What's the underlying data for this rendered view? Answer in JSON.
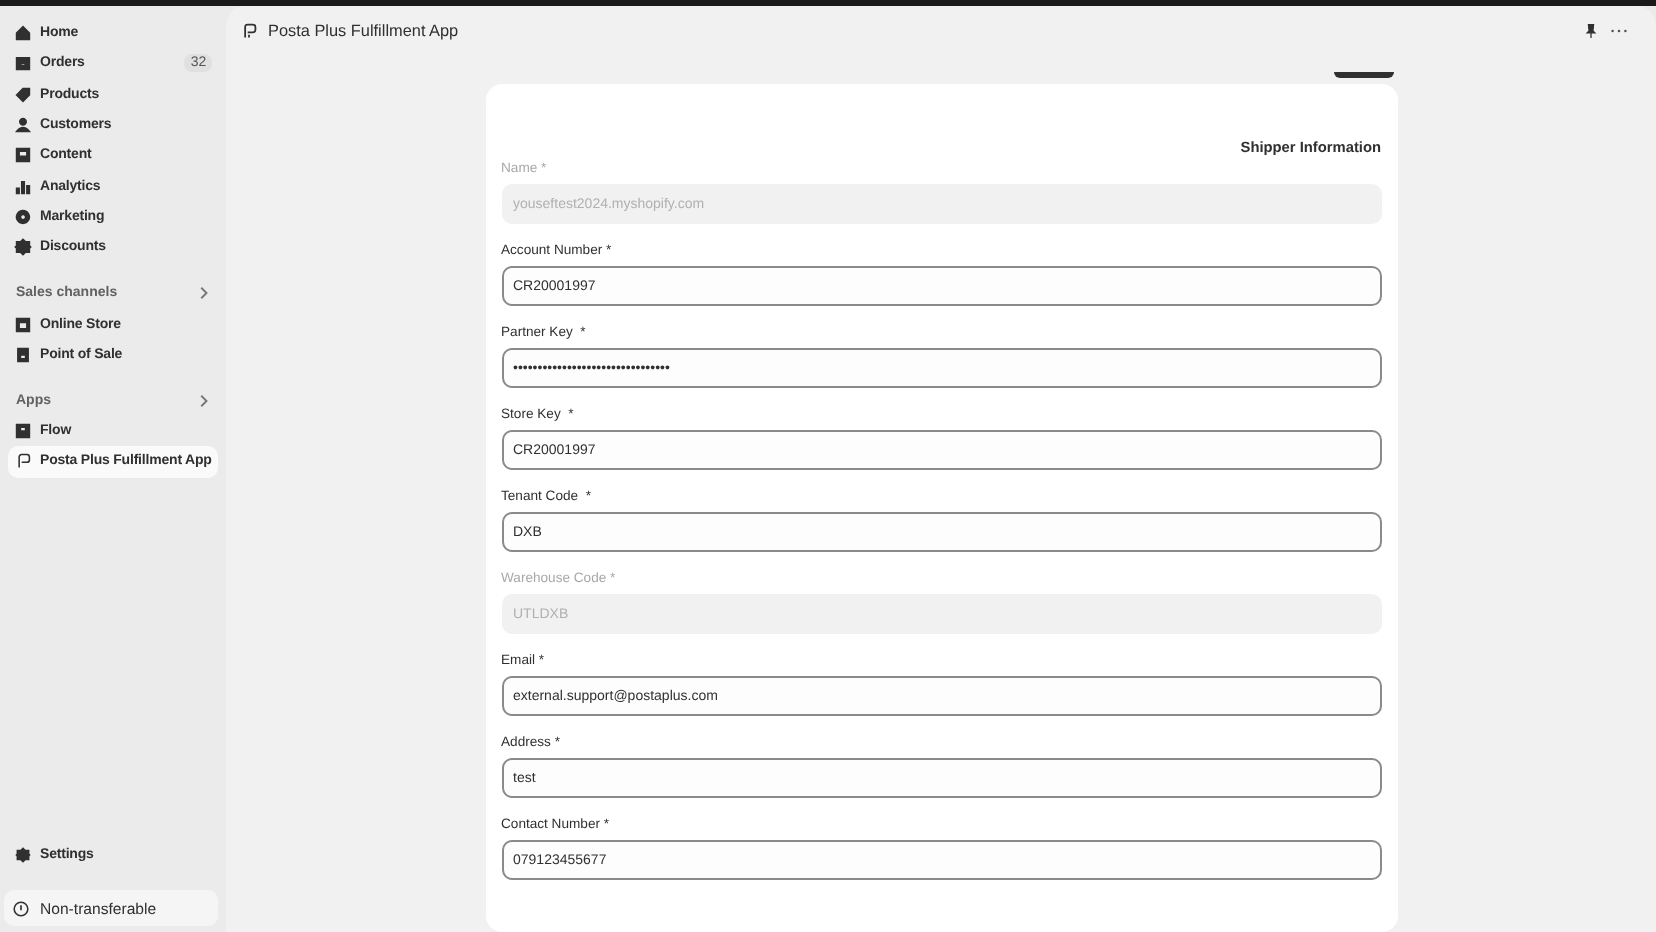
{
  "sidebar": {
    "items": [
      {
        "label": "Home",
        "selected": false
      },
      {
        "label": "Orders",
        "badge": "32",
        "selected": false
      },
      {
        "label": "Products",
        "selected": false
      },
      {
        "label": "Customers",
        "selected": false
      },
      {
        "label": "Content",
        "selected": false
      },
      {
        "label": "Analytics",
        "selected": false
      },
      {
        "label": "Marketing",
        "selected": false
      },
      {
        "label": "Discounts",
        "selected": false
      }
    ],
    "sections": [
      {
        "title": "Sales channels",
        "items": [
          {
            "label": "Online Store",
            "selected": false
          },
          {
            "label": "Point of Sale",
            "selected": false
          }
        ]
      },
      {
        "title": "Apps",
        "items": [
          {
            "label": "Flow",
            "selected": false
          },
          {
            "label": "Posta Plus Fulfillment App",
            "selected": true
          }
        ]
      }
    ],
    "settings": "Settings",
    "footer": "Non-transferable"
  },
  "app_title": "Posta Plus Fulfillment App",
  "form": {
    "heading": "Shipper Information",
    "fields": [
      {
        "label": "Name *",
        "value": "youseftest2024.myshopify.com",
        "disabled": true
      },
      {
        "label": "Account Number *",
        "value": "CR20001997",
        "disabled": false
      },
      {
        "label": "Partner Key  *",
        "value": "••••••••••••••••••••••••••••••••",
        "disabled": false
      },
      {
        "label": "Store Key  *",
        "value": "CR20001997",
        "disabled": false
      },
      {
        "label": "Tenant Code  *",
        "value": "DXB",
        "disabled": false
      },
      {
        "label": "Warehouse Code *",
        "value": "UTLDXB",
        "disabled": true
      },
      {
        "label": "Email *",
        "value": "external.support@postaplus.com",
        "disabled": false
      },
      {
        "label": "Address *",
        "value": "test",
        "disabled": false
      },
      {
        "label": "Contact Number *",
        "value": "079123455677",
        "disabled": false
      }
    ]
  }
}
